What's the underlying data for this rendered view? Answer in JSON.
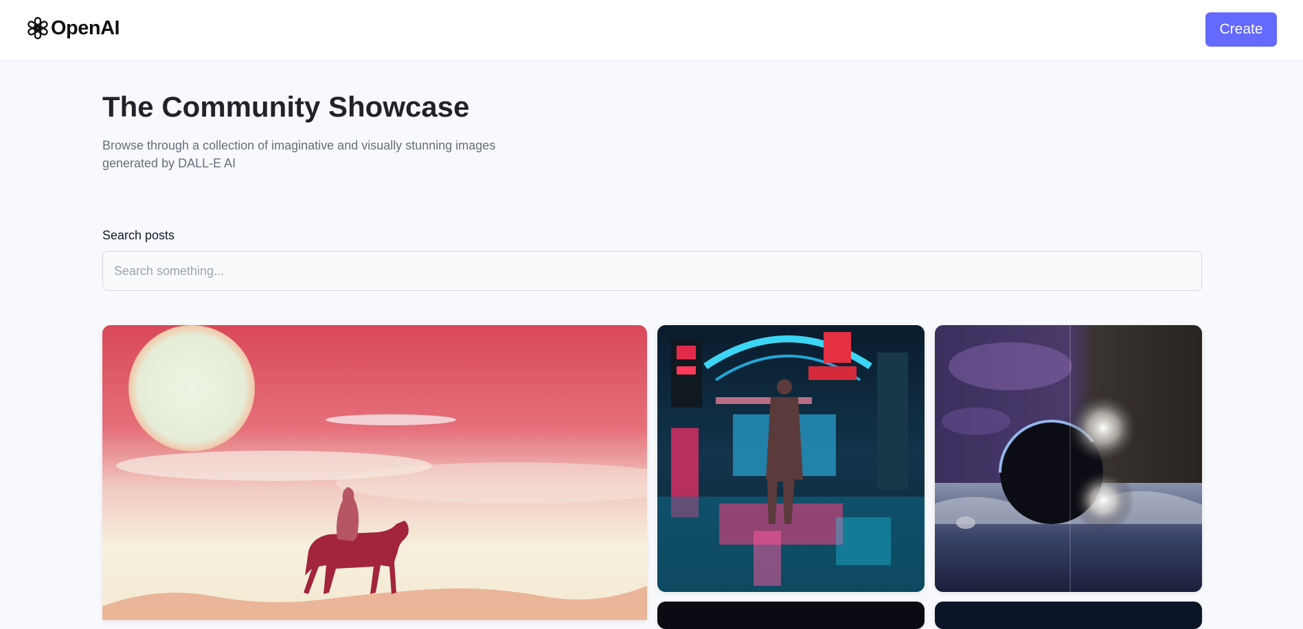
{
  "header": {
    "brand": "OpenAI",
    "logo_icon": "openai-logo-icon",
    "create_label": "Create",
    "accent_color": "#6469ff"
  },
  "main": {
    "title": "The Community Showcase",
    "subtitle": "Browse through a collection of imaginative and visually stunning images generated by DALL-E AI"
  },
  "search": {
    "label": "Search posts",
    "placeholder": "Search something...",
    "value": ""
  },
  "gallery": {
    "cards": [
      {
        "icon": "horse-rider-sunset-image"
      },
      {
        "icon": "neon-city-street-image"
      },
      {
        "icon": "space-planet-eclipse-image"
      },
      {
        "icon": "dark-image"
      },
      {
        "icon": "night-sky-image"
      }
    ]
  }
}
